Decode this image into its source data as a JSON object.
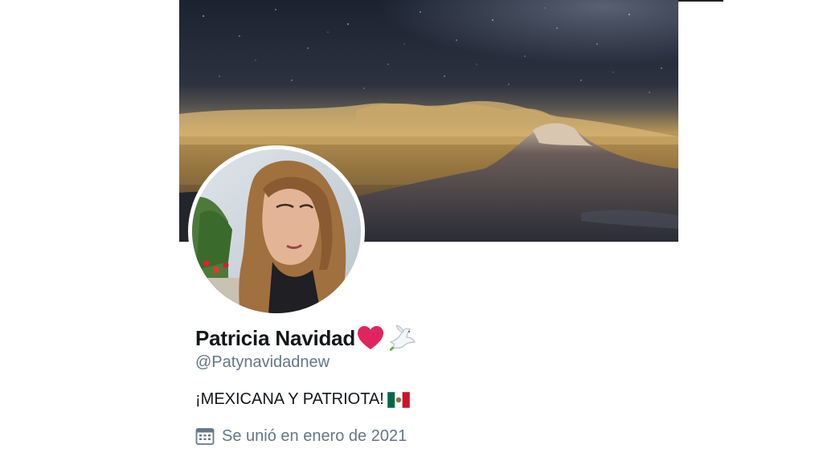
{
  "profile": {
    "display_name": "Patricia Navidad",
    "name_emojis": [
      "heart-icon",
      "dove-icon"
    ],
    "handle": "@Patynavidadnew",
    "bio": "¡MEXICANA Y PATRIOTA!",
    "bio_emoji": "mexico-flag-icon",
    "joined": "Se unió en enero de 2021",
    "joined_icon": "calendar-icon"
  },
  "banner": {
    "subject": "volcano-under-starry-night-sky"
  },
  "colors": {
    "name_text": "#14171a",
    "secondary_text": "#657786",
    "heart": "#e0245e"
  }
}
